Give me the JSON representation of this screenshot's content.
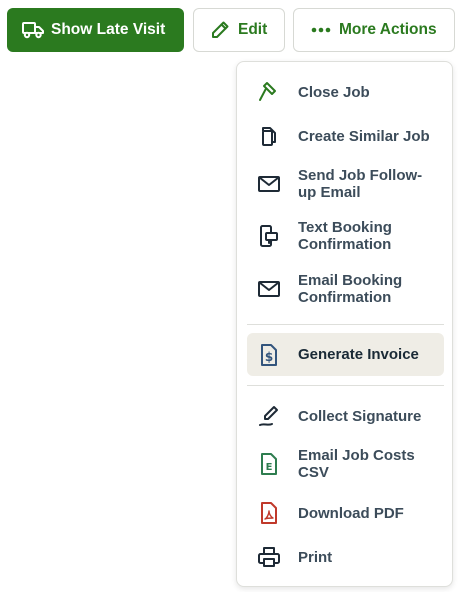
{
  "toolbar": {
    "show_late_visit_label": "Show Late Visit",
    "edit_label": "Edit",
    "more_actions_label": "More Actions"
  },
  "menu": {
    "items": [
      {
        "label": "Close Job",
        "icon": "hammer-icon"
      },
      {
        "label": "Create Similar Job",
        "icon": "copy-icon"
      },
      {
        "label": "Send Job Follow-up Email",
        "icon": "envelope-icon"
      },
      {
        "label": "Text Booking Confirmation",
        "icon": "phone-text-icon"
      },
      {
        "label": "Email Booking Confirmation",
        "icon": "envelope-icon"
      },
      {
        "label": "Generate Invoice",
        "icon": "invoice-icon",
        "highlighted": true
      },
      {
        "label": "Collect Signature",
        "icon": "signature-pen-icon"
      },
      {
        "label": "Email Job Costs CSV",
        "icon": "excel-file-icon"
      },
      {
        "label": "Download PDF",
        "icon": "pdf-file-icon"
      },
      {
        "label": "Print",
        "icon": "printer-icon"
      }
    ]
  },
  "colors": {
    "primary_green": "#2b7a1f",
    "menu_text": "#3c4c5a",
    "highlight_bg": "#efede6",
    "invoice_blue": "#33557d",
    "pdf_red": "#c0392b"
  }
}
